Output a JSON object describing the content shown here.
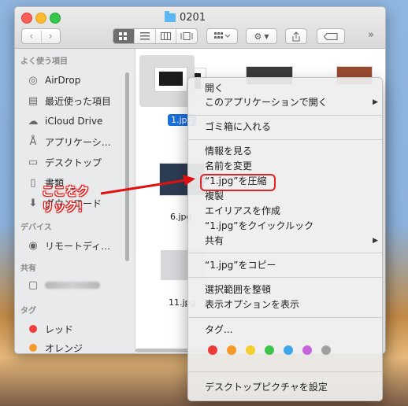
{
  "window": {
    "title": "0201"
  },
  "toolbar": {
    "back": "‹",
    "forward": "›",
    "more": "»"
  },
  "sidebar": {
    "favorites_header": "よく使う項目",
    "favorites": [
      {
        "label": "AirDrop",
        "icon": "airdrop-icon"
      },
      {
        "label": "最近使った項目",
        "icon": "recents-icon"
      },
      {
        "label": "iCloud Drive",
        "icon": "cloud-icon"
      },
      {
        "label": "アプリケーシ…",
        "icon": "applications-icon"
      },
      {
        "label": "デスクトップ",
        "icon": "desktop-icon"
      },
      {
        "label": "書類",
        "icon": "documents-icon"
      },
      {
        "label": "ダウンロード",
        "icon": "downloads-icon"
      }
    ],
    "devices_header": "デバイス",
    "devices": [
      {
        "label": "リモートディ…",
        "icon": "disc-icon"
      }
    ],
    "shared_header": "共有",
    "tags_header": "タグ",
    "tags": [
      {
        "label": "レッド",
        "color": "#f23b3b"
      },
      {
        "label": "オレンジ",
        "color": "#f59b2c"
      }
    ]
  },
  "files": [
    {
      "label": "1.jpg",
      "selected": true
    },
    {
      "label": "6.jpg"
    },
    {
      "label": "11.jpg"
    }
  ],
  "context_menu": {
    "items": [
      {
        "label": "開く"
      },
      {
        "label": "このアプリケーションで開く",
        "submenu": true
      },
      {
        "label": "ゴミ箱に入れる"
      },
      {
        "label": "情報を見る"
      },
      {
        "label": "名前を変更"
      },
      {
        "label": "“1.jpg”を圧縮"
      },
      {
        "label": "複製"
      },
      {
        "label": "エイリアスを作成"
      },
      {
        "label": "“1.jpg”をクイックルック"
      },
      {
        "label": "共有",
        "submenu": true
      },
      {
        "label": "“1.jpg”をコピー"
      },
      {
        "label": "選択範囲を整頓"
      },
      {
        "label": "表示オプションを表示"
      },
      {
        "label": "タグ..."
      },
      {
        "label": "デスクトップピクチャを設定"
      }
    ],
    "tag_colors": [
      "#f03a3a",
      "#f59a2a",
      "#f5cf2a",
      "#3ec44a",
      "#3aa7ec",
      "#c562dd",
      "#a0a0a0"
    ]
  },
  "annotation": {
    "text": "ここをクリック！",
    "color": "#e01010"
  }
}
